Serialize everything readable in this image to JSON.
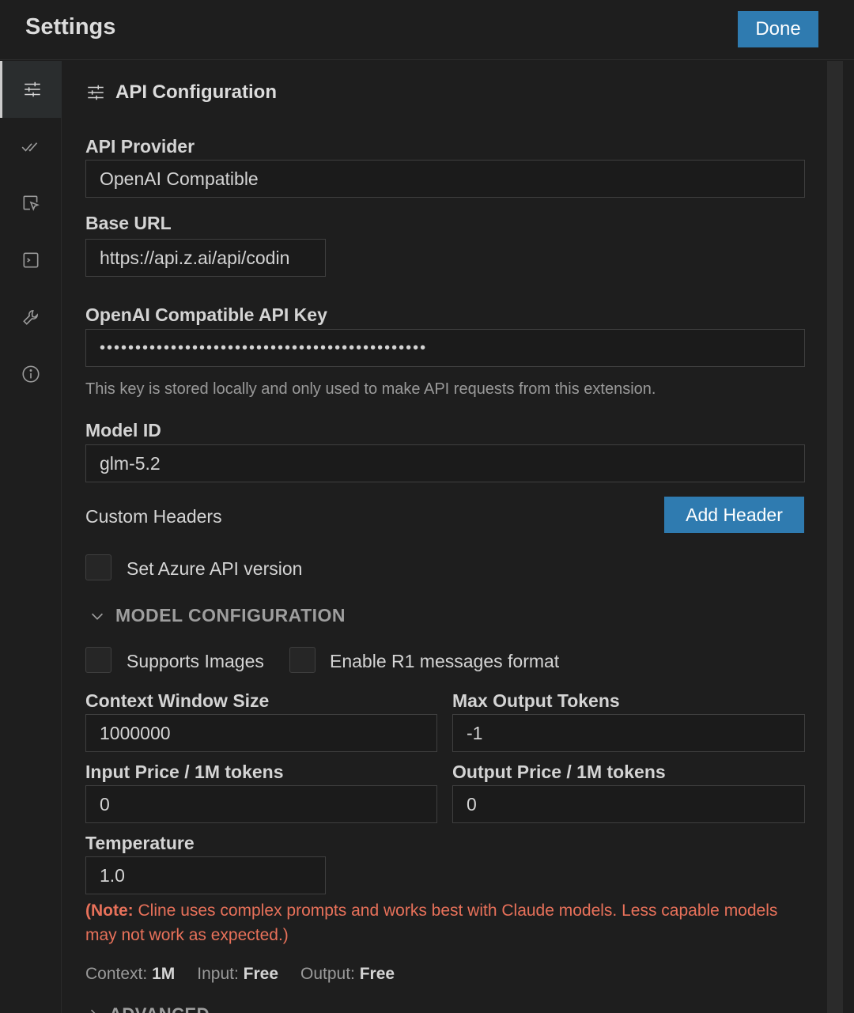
{
  "header": {
    "title": "Settings",
    "done_label": "Done"
  },
  "sidebar": {
    "items": [
      {
        "icon": "sliders-icon",
        "active": true
      },
      {
        "icon": "double-check-icon",
        "active": false
      },
      {
        "icon": "cursor-box-icon",
        "active": false
      },
      {
        "icon": "terminal-icon",
        "active": false
      },
      {
        "icon": "wrench-icon",
        "active": false
      },
      {
        "icon": "info-icon",
        "active": false
      }
    ]
  },
  "section": {
    "title": "API Configuration"
  },
  "api_provider": {
    "label": "API Provider",
    "value": "OpenAI Compatible"
  },
  "base_url": {
    "label": "Base URL",
    "value": "https://api.z.ai/api/codin"
  },
  "api_key": {
    "label": "OpenAI Compatible API Key",
    "value": "••••••••••••••••••••••••••••••••••••••••••••••",
    "hint": "This key is stored locally and only used to make API requests from this extension."
  },
  "model_id": {
    "label": "Model ID",
    "value": "glm-5.2"
  },
  "custom_headers": {
    "label": "Custom Headers",
    "add_label": "Add Header"
  },
  "azure": {
    "label": "Set Azure API version",
    "checked": false
  },
  "model_config": {
    "title": "MODEL CONFIGURATION",
    "supports_images": {
      "label": "Supports Images",
      "checked": false
    },
    "r1_format": {
      "label": "Enable R1 messages format",
      "checked": false
    },
    "context_window": {
      "label": "Context Window Size",
      "value": "1000000"
    },
    "max_output": {
      "label": "Max Output Tokens",
      "value": "-1"
    },
    "input_price": {
      "label": "Input Price / 1M tokens",
      "value": "0"
    },
    "output_price": {
      "label": "Output Price / 1M tokens",
      "value": "0"
    },
    "temperature": {
      "label": "Temperature",
      "value": "1.0"
    }
  },
  "note": {
    "prefix": "(Note: ",
    "text": "Cline uses complex prompts and works best with Claude models. Less capable models may not work as expected.)"
  },
  "stats": {
    "context_label": "Context:",
    "context_value": "1M",
    "input_label": "Input:",
    "input_value": "Free",
    "output_label": "Output:",
    "output_value": "Free"
  },
  "advanced": {
    "title": "ADVANCED"
  }
}
